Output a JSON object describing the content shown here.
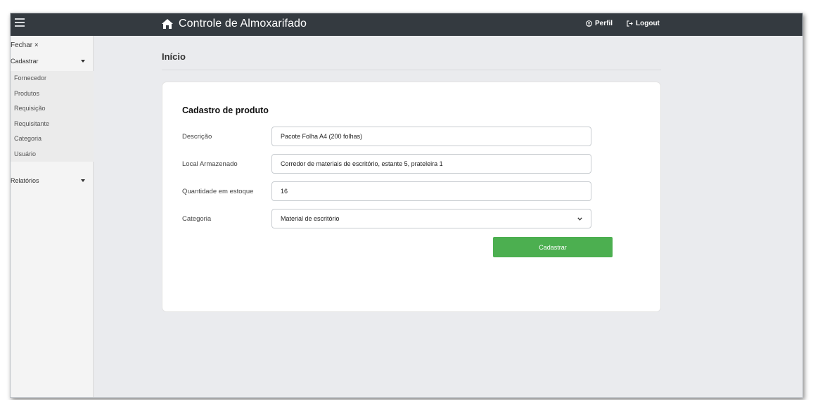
{
  "topbar": {
    "title": "Controle de Almoxarifado",
    "brand_icon": "home-icon",
    "nav": [
      {
        "label": "Perfil",
        "icon": "user-circle-icon"
      },
      {
        "label": "Logout",
        "icon": "logout-icon"
      }
    ],
    "bg_color": "#343a40"
  },
  "sidebar": {
    "close_label": "Fechar ×",
    "cadastrar_label": "Cadastrar",
    "submenu": [
      "Fornecedor",
      "Produtos",
      "Requisição",
      "Requisitante",
      "Categoria",
      "Usuário"
    ],
    "relatorios_label": "Relatórios"
  },
  "main": {
    "page_title": "Início"
  },
  "form": {
    "title": "Cadastro de produto",
    "fields": [
      {
        "label": "Descrição",
        "value": "Pacote Folha A4 (200 folhas)"
      },
      {
        "label": "Local Armazenado",
        "value": "Corredor de materiais de escritório, estante 5, prateleira 1"
      },
      {
        "label": "Quantidade em estoque",
        "value": "16"
      },
      {
        "label": "Categoria",
        "value": "Material de escritório"
      }
    ],
    "submit_label": "Cadastrar",
    "submit_color": "#4caf50"
  }
}
